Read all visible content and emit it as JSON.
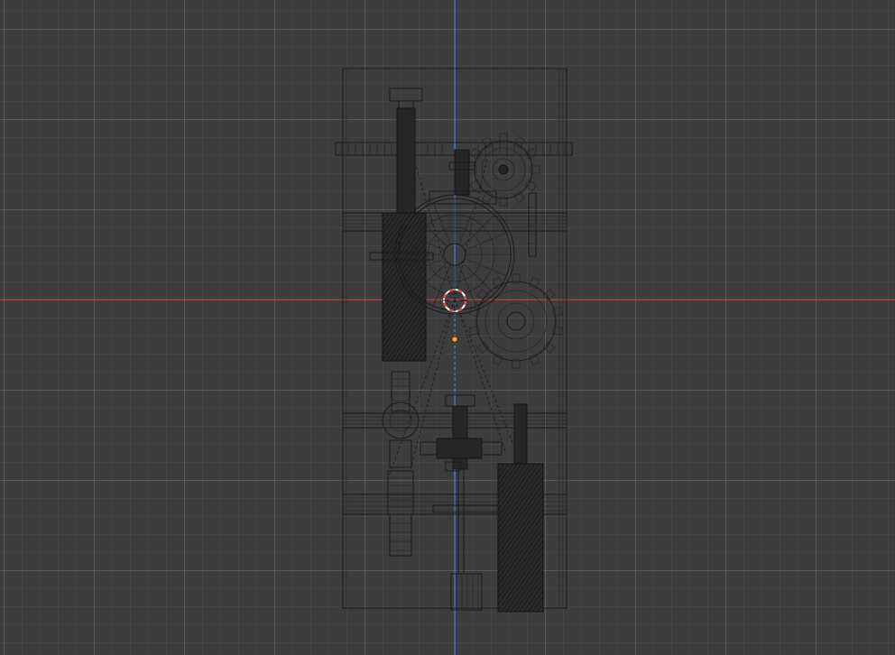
{
  "viewport": {
    "mode": "wireframe",
    "background": "#3d3d3d",
    "grid_minor": "#474747",
    "grid_major": "#505050",
    "x_axis_color": "#b0393e",
    "y_axis_color": "#3a7bd5",
    "wire_color": "#1c1c1c",
    "cursor_color": "#e04848",
    "origin_color": "#f0a030"
  },
  "scene": {
    "objects": [
      "frame-plate",
      "top-rack",
      "upper-pinion-gear",
      "left-lead-screw",
      "main-wheel",
      "right-spur-gear",
      "horizontal-crossbars",
      "lower-left-gear-stack",
      "lower-center-shaft",
      "lower-right-roller"
    ]
  },
  "overlay": {
    "cursor_icon": "3d-cursor-icon",
    "origin_icon": "origin-point-icon"
  }
}
